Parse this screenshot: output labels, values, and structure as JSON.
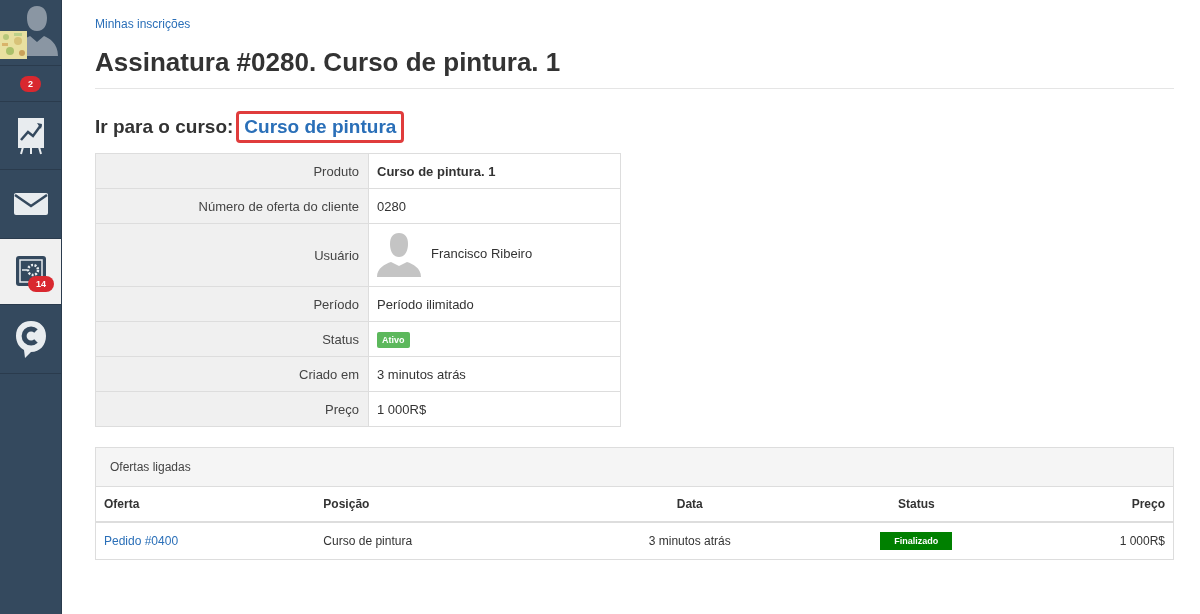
{
  "sidebar": {
    "items": [
      {
        "kind": "avatar",
        "selected": false
      },
      {
        "kind": "badge",
        "badge": "2",
        "selected": false
      },
      {
        "kind": "chart",
        "selected": false
      },
      {
        "kind": "mail",
        "selected": false
      },
      {
        "kind": "settings",
        "badge": "14",
        "selected": true
      },
      {
        "kind": "chat",
        "selected": false
      }
    ]
  },
  "breadcrumb": "Minhas inscrições",
  "title": "Assinatura #0280. Curso de pintura. 1",
  "course_link": {
    "label": "Ir para o curso:",
    "link": "Curso de pintura",
    "highlighted": true
  },
  "details": [
    {
      "label": "Produto",
      "value": "Curso de pintura. 1",
      "kind": "bold"
    },
    {
      "label": "Número de oferta do cliente",
      "value": "0280",
      "kind": "text"
    },
    {
      "label": "Usuário",
      "value": "Francisco Ribeiro",
      "kind": "user"
    },
    {
      "label": "Período",
      "value": "Período ilimitado",
      "kind": "text"
    },
    {
      "label": "Status",
      "value": "Ativo",
      "kind": "status",
      "color": "#5cb85c"
    },
    {
      "label": "Criado em",
      "value": "3 minutos atrás",
      "kind": "text"
    },
    {
      "label": "Preço",
      "value": "1 000R$",
      "kind": "text"
    }
  ],
  "linked_offers": {
    "title": "Ofertas ligadas",
    "columns": [
      {
        "label": "Oferta"
      },
      {
        "label": "Posição"
      },
      {
        "label": "Data"
      },
      {
        "label": "Status"
      },
      {
        "label": "Preço"
      }
    ],
    "rows": [
      {
        "offer": "Pedido #0400",
        "position": "Curso de pintura",
        "date": "3 minutos atrás",
        "status": "Finalizado",
        "color": "#008000",
        "price": "1 000R$"
      }
    ]
  }
}
